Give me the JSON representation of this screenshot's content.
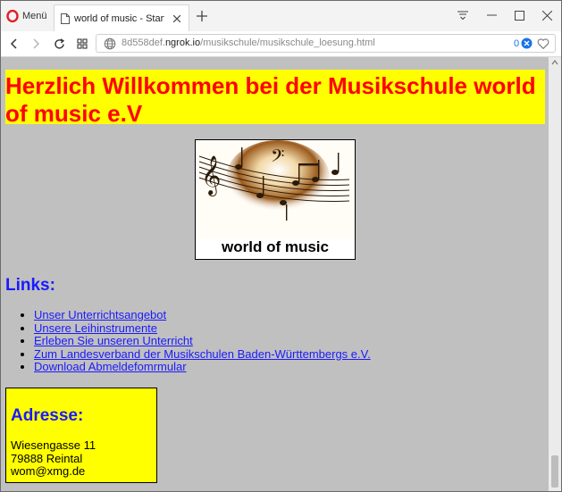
{
  "browser": {
    "menu_label": "Menü",
    "tab_title": "world of music - Startseite",
    "url_prefix": "8d558def.",
    "url_host": "ngrok.io",
    "url_path": "/musikschule/musikschule_loesung.html",
    "adblock_count": "0",
    "icons": [
      "opera-logo-icon",
      "page-icon",
      "close-icon",
      "plus-icon",
      "stash-icon",
      "minimize-icon",
      "maximize-icon",
      "close-window-icon",
      "back-icon",
      "forward-icon",
      "reload-icon",
      "speed-dial-icon",
      "globe-icon",
      "adblock-icon",
      "heart-icon"
    ]
  },
  "page": {
    "heading": "Herzlich Willkommen bei der Musikschule world of music e.V",
    "logo_text": "world of music",
    "links_heading": "Links:",
    "links": [
      "Unser Unterrichtsangebot",
      "Unsere Leihinstrumente",
      "Erleben Sie unseren Unterricht",
      "Zum Landesverband der Musikschulen Baden-Württembergs e.V.",
      "Download Abmeldefomrmular"
    ],
    "address_heading": "Adresse:",
    "address_lines": [
      "Wiesengasse 11",
      "79888 Reintal",
      "wom@xmg.de"
    ]
  },
  "colors": {
    "banner_bg": "#ffff00",
    "heading_text": "#ff0000",
    "link_blue": "#1a1aff",
    "page_bg": "#c0c0c0"
  }
}
